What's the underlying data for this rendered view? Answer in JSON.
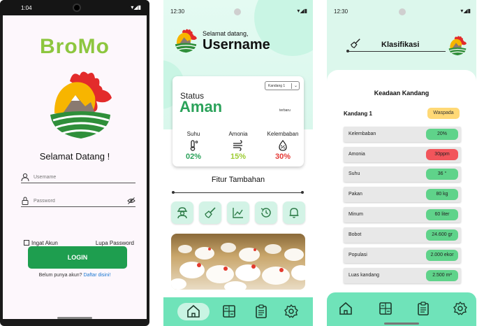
{
  "colors": {
    "brand_green": "#8dc63f",
    "button_green": "#1e9e4f",
    "safe_green": "#2ba25a",
    "chip_green": "#5fd38a",
    "chip_red": "#f2555b",
    "chip_yellow": "#ffd976",
    "amonia_yellow": "#9ccc31",
    "danger_red": "#e53935",
    "mint_nav": "#6fe3b9"
  },
  "login": {
    "status_time": "1:04",
    "brand": "BroMo",
    "welcome": "Selamat Datang !",
    "username_placeholder": "Username",
    "password_placeholder": "Password",
    "remember_label": "Ingat Akun",
    "forgot_label": "Lupa Password",
    "login_label": "LOGIN",
    "register_text": "Belum punya akun?",
    "register_link": "Daftar disini!"
  },
  "dashboard": {
    "status_time": "12:30",
    "greeting": "Selamat datang,",
    "username": "Username",
    "kandang_select": "Kandang 1",
    "status_label": "Status",
    "status_value": "Aman",
    "updated_label": "terbaru",
    "metrics": [
      {
        "label": "Suhu",
        "value": "02%",
        "icon": "thermometer-icon"
      },
      {
        "label": "Amonia",
        "value": "15%",
        "icon": "wind-icon"
      },
      {
        "label": "Kelembaban",
        "value": "30%",
        "icon": "humidity-icon"
      }
    ],
    "fitur_title": "Fitur Tambahan",
    "features": [
      "farmer-icon",
      "clean-icon",
      "chart-icon",
      "history-icon",
      "bell-icon"
    ],
    "nav": [
      "home-icon",
      "calculator-icon",
      "clipboard-icon",
      "settings-icon"
    ]
  },
  "klasifikasi": {
    "status_time": "12:30",
    "title": "Klasifikasi",
    "section_title": "Keadaan Kandang",
    "kandang_label": "Kandang  1",
    "kandang_status": "Waspada",
    "rows": [
      {
        "label": "Kelembaban",
        "value": "20%",
        "level": "green"
      },
      {
        "label": "Amonia",
        "value": "30ppm",
        "level": "red"
      },
      {
        "label": "Suhu",
        "value": "36 °",
        "level": "green"
      },
      {
        "label": "Pakan",
        "value": "80 kg",
        "level": "green"
      },
      {
        "label": "Minum",
        "value": "60 liter",
        "level": "green"
      },
      {
        "label": "Bobot",
        "value": "24.600 gr",
        "level": "green"
      },
      {
        "label": "Populasi",
        "value": "2.000 ekor",
        "level": "green"
      },
      {
        "label": "Luas kandang",
        "value": "2.500 m²",
        "level": "green"
      }
    ],
    "nav": [
      "home-icon",
      "calculator-icon",
      "clipboard-icon",
      "settings-icon"
    ]
  }
}
